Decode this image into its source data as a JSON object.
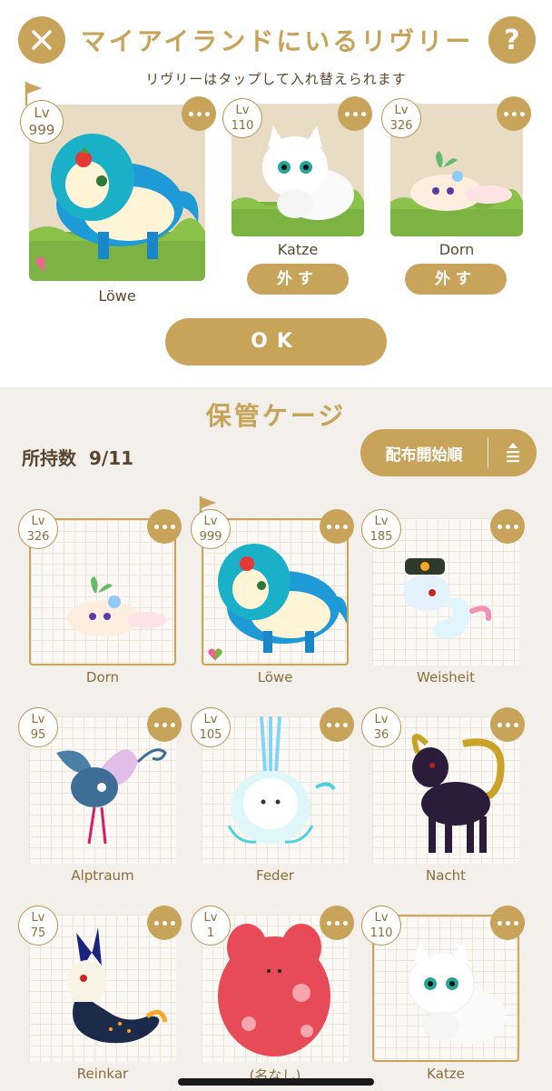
{
  "header": {
    "title": "マイアイランドにいるリヴリー",
    "subtitle": "リヴリーはタップして入れ替えられます",
    "close_icon": "close-icon",
    "help_label": "?"
  },
  "island_slots": [
    {
      "level_prefix": "Lv",
      "level": "999",
      "name": "Löwe",
      "flagged": true,
      "has_heart": true
    },
    {
      "level_prefix": "Lv",
      "level": "110",
      "name": "Katze",
      "remove_label": "外す"
    },
    {
      "level_prefix": "Lv",
      "level": "326",
      "name": "Dorn",
      "remove_label": "外す"
    }
  ],
  "ok_label": "OK",
  "storage": {
    "title": "保管ケージ",
    "owned_label": "所持数",
    "owned_count": "9/11",
    "sort_label": "配布開始順",
    "sort_icon": "sort-order-icon"
  },
  "grid": [
    {
      "level_prefix": "Lv",
      "level": "326",
      "name": "Dorn",
      "active": true
    },
    {
      "level_prefix": "Lv",
      "level": "999",
      "name": "Löwe",
      "active": true,
      "flagged": true,
      "has_heart": true
    },
    {
      "level_prefix": "Lv",
      "level": "185",
      "name": "Weisheit",
      "active": false
    },
    {
      "level_prefix": "Lv",
      "level": "95",
      "name": "Alptraum",
      "active": false
    },
    {
      "level_prefix": "Lv",
      "level": "105",
      "name": "Feder",
      "active": false
    },
    {
      "level_prefix": "Lv",
      "level": "36",
      "name": "Nacht",
      "active": false
    },
    {
      "level_prefix": "Lv",
      "level": "75",
      "name": "Reinkar",
      "active": false
    },
    {
      "level_prefix": "Lv",
      "level": "1",
      "name": "(名なし)",
      "active": false
    },
    {
      "level_prefix": "Lv",
      "level": "110",
      "name": "Katze",
      "active": true
    }
  ],
  "colors": {
    "accent": "#c8a45a",
    "text": "#5a4630",
    "storage_bg": "#f3efea"
  }
}
